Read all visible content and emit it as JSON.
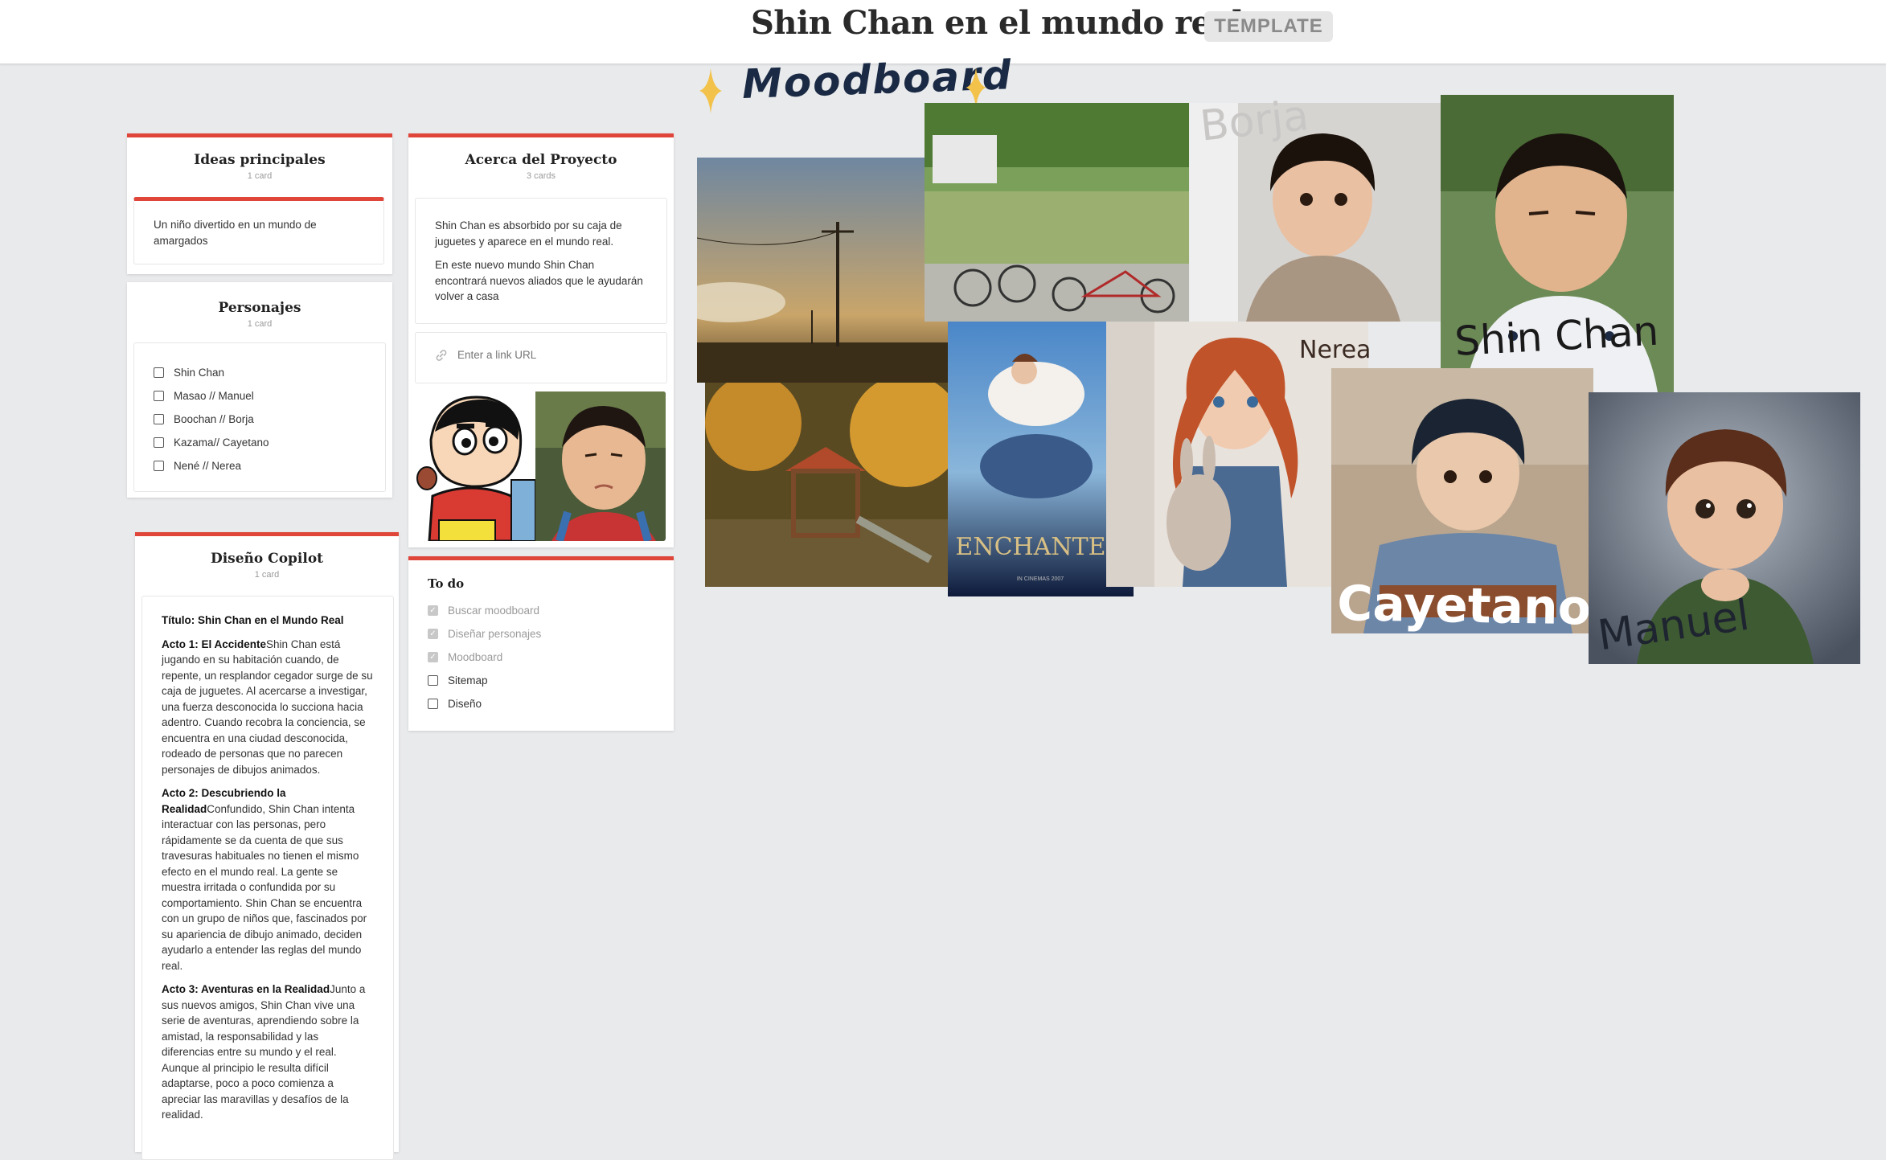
{
  "header": {
    "title": "Shin Chan en el mundo real",
    "badge": "TEMPLATE"
  },
  "columns": {
    "ideas": {
      "title": "Ideas principales",
      "count": "1 card",
      "card_text": "Un niño divertido en un mundo de amargados"
    },
    "personajes": {
      "title": "Personajes",
      "count": "1 card",
      "items": [
        "Shin Chan",
        "Masao // Manuel",
        "Boochan // Borja",
        "Kazama// Cayetano",
        "Nené // Nerea"
      ]
    },
    "acerca": {
      "title": "Acerca del Proyecto",
      "count": "3 cards",
      "para1": "Shin Chan es absorbido por su caja de juguetes y aparece en el mundo real.",
      "para2": "En este nuevo mundo Shin Chan encontrará nuevos aliados que le ayudarán volver a casa",
      "link_placeholder": "Enter a link URL"
    },
    "todo": {
      "title": "To do",
      "items": [
        {
          "label": "Buscar moodboard",
          "done": true
        },
        {
          "label": "Diseñar personajes",
          "done": true
        },
        {
          "label": "Moodboard",
          "done": true
        },
        {
          "label": "Sitemap",
          "done": false
        },
        {
          "label": "Diseño",
          "done": false
        }
      ]
    },
    "copilot": {
      "title": "Diseño Copilot",
      "count": "1 card",
      "heading": "Título: Shin Chan en el Mundo Real",
      "act1_title": "Acto 1: El Accidente",
      "act1_text": "Shin Chan está jugando en su habitación cuando, de repente, un resplandor cegador surge de su caja de juguetes. Al acercarse a investigar, una fuerza desconocida lo succiona hacia adentro. Cuando recobra la conciencia, se encuentra en una ciudad desconocida, rodeado de personas que no parecen personajes de dibujos animados.",
      "act2_title": "Acto 2: Descubriendo la Realidad",
      "act2_text": "Confundido, Shin Chan intenta interactuar con las personas, pero rápidamente se da cuenta de que sus travesuras habituales no tienen el mismo efecto en el mundo real. La gente se muestra irritada o confundida por su comportamiento. Shin Chan se encuentra con un grupo de niños que, fascinados por su apariencia de dibujo animado, deciden ayudarlo a entender las reglas del mundo real.",
      "act3_title": "Acto 3: Aventuras en la Realidad",
      "act3_text": "Junto a sus nuevos amigos, Shin Chan vive una serie de aventuras, aprendiendo sobre la amistad, la responsabilidad y las diferencias entre su mundo y el real. Aunque al principio le resulta difícil adaptarse, poco a poco comienza a apreciar las maravillas y desafíos de la realidad."
    }
  },
  "moodboard": {
    "title": "Moodboard",
    "labels": {
      "borja": "Borja",
      "nerea": "Nerea",
      "shinchan": "Shin Chan",
      "cayetano": "Cayetano",
      "manuel": "Manuel"
    },
    "poster_text": "ENCHANTED",
    "poster_small": "IN CINEMAS 2007"
  },
  "colors": {
    "accent": "#e0453a",
    "background": "#e9eaec",
    "badge_bg": "#e6e6e6"
  }
}
